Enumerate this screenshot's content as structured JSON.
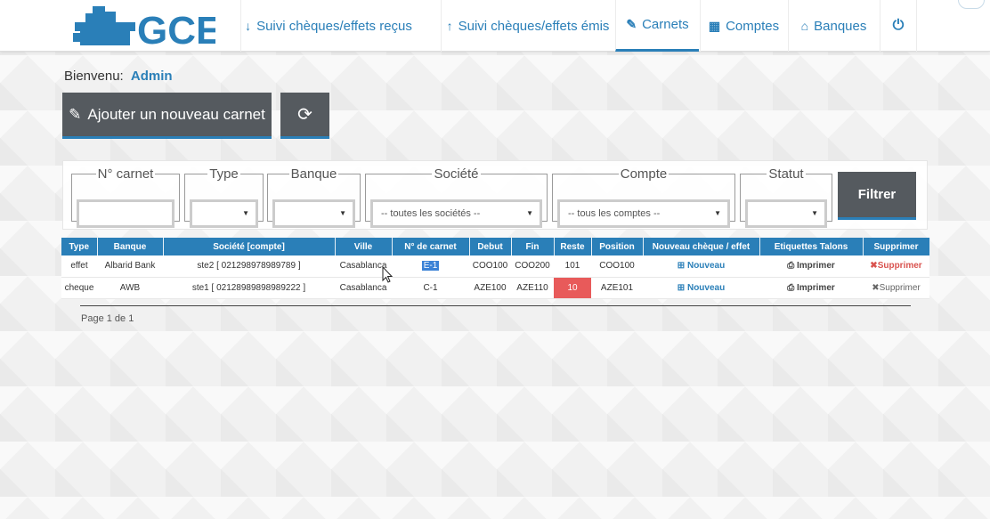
{
  "app": {
    "logo_text": "GCE"
  },
  "nav": {
    "items": [
      {
        "icon": "↓",
        "label": "Suivi chèques/effets reçus"
      },
      {
        "icon": "↑",
        "label": "Suivi chèques/effets émis"
      },
      {
        "icon": "✎",
        "label": "Carnets"
      },
      {
        "icon": "▦",
        "label": "Comptes"
      },
      {
        "icon": "⌂",
        "label": "Banques"
      },
      {
        "icon": "⏻",
        "label": ""
      }
    ],
    "active": "Carnets"
  },
  "welcome": {
    "label": "Bienvenu:",
    "user": "Admin"
  },
  "actions": {
    "add_label": "Ajouter un nouveau carnet",
    "add_icon": "✎",
    "refresh_icon": "⟳"
  },
  "filters": {
    "carnet": {
      "legend": "N° carnet",
      "value": ""
    },
    "type": {
      "legend": "Type",
      "value": ""
    },
    "banque": {
      "legend": "Banque",
      "value": ""
    },
    "societe": {
      "legend": "Société",
      "value": "-- toutes les sociétés --"
    },
    "compte": {
      "legend": "Compte",
      "value": "-- tous les comptes --"
    },
    "statut": {
      "legend": "Statut",
      "value": ""
    },
    "button": "Filtrer"
  },
  "table": {
    "headers": [
      "Type",
      "Banque",
      "Société [compte]",
      "Ville",
      "N° de carnet",
      "Debut",
      "Fin",
      "Reste",
      "Position",
      "Nouveau chèque / effet",
      "Etiquettes Talons",
      "Supprimer"
    ],
    "rows": [
      {
        "type": "effet",
        "banque": "Albarid Bank",
        "societe": "ste2 [ 021298978989789 ]",
        "ville": "Casablanca",
        "carnet": "E-1",
        "debut": "COO100",
        "fin": "COO200",
        "reste": "101",
        "position": "COO100",
        "nouveau": "Nouveau",
        "imprimer": "Imprimer",
        "supprimer": "Supprimer"
      },
      {
        "type": "cheque",
        "banque": "AWB",
        "societe": "ste1 [ 02128989898989222 ]",
        "ville": "Casablanca",
        "carnet": "C-1",
        "debut": "AZE100",
        "fin": "AZE110",
        "reste": "10",
        "position": "AZE101",
        "nouveau": "Nouveau",
        "imprimer": "Imprimer",
        "supprimer": "Supprimer"
      }
    ]
  },
  "pager": {
    "text": "Page 1 de 1"
  },
  "colors": {
    "accent": "#2a7fb8",
    "button_bg": "#555a5f",
    "warning": "#e85a5a",
    "danger": "#d9534f"
  }
}
